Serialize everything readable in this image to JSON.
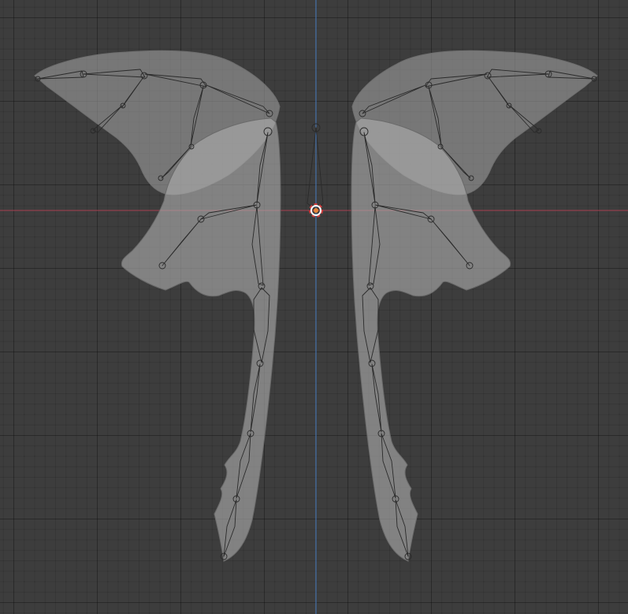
{
  "viewport": {
    "background": "#3d3d3d",
    "grid_line_color": "#2f2f2f",
    "x_axis_color": "#a6404e",
    "y_axis_color": "#4a7ec2"
  },
  "scene": {
    "objects": [
      {
        "kind": "mesh",
        "name": "wing-mesh"
      },
      {
        "kind": "armature",
        "name": "wing-armature"
      },
      {
        "kind": "origin",
        "name": "object-origin",
        "colors": [
          "#e8833a",
          "#ffffff",
          "#d33b3b"
        ]
      }
    ]
  }
}
